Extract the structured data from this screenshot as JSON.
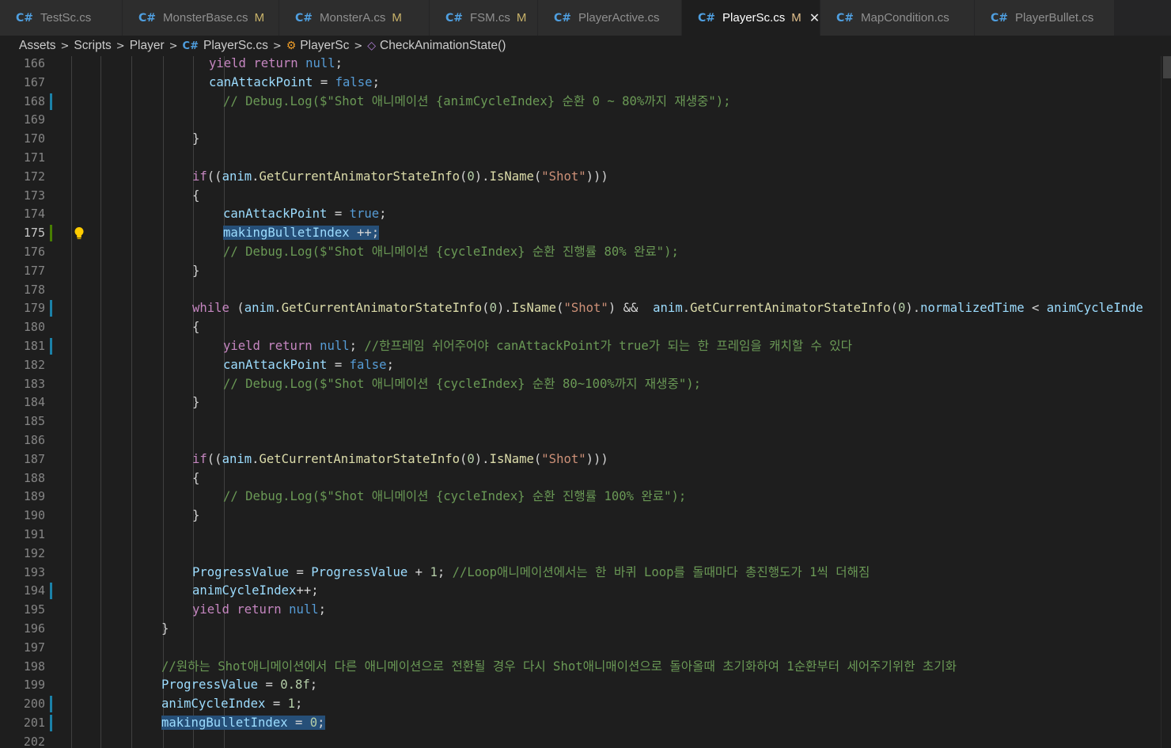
{
  "tabs": [
    {
      "label": "TestSc.cs",
      "modified": "",
      "active": false
    },
    {
      "label": "MonsterBase.cs",
      "modified": "M",
      "active": false
    },
    {
      "label": "MonsterA.cs",
      "modified": "M",
      "active": false
    },
    {
      "label": "FSM.cs",
      "modified": "M",
      "active": false
    },
    {
      "label": "PlayerActive.cs",
      "modified": "",
      "active": false
    },
    {
      "label": "PlayerSc.cs",
      "modified": "M",
      "active": true
    },
    {
      "label": "MapCondition.cs",
      "modified": "",
      "active": false
    },
    {
      "label": "PlayerBullet.cs",
      "modified": "",
      "active": false
    }
  ],
  "breadcrumb": {
    "assets": "Assets",
    "scripts": "Scripts",
    "player": "Player",
    "file": "PlayerSc.cs",
    "class": "PlayerSc",
    "method": "CheckAnimationState()"
  },
  "editor": {
    "current_line": "175",
    "lines": [
      {
        "n": "166",
        "g": "",
        "indent": 2,
        "tokens": [
          [
            "yl",
            "yield "
          ],
          [
            "yl",
            "return "
          ],
          [
            "kw2",
            "null"
          ],
          [
            "",
            "; "
          ]
        ]
      },
      {
        "n": "167",
        "g": "",
        "indent": 2,
        "tokens": [
          [
            "id",
            "canAttackPoint"
          ],
          [
            "",
            " = "
          ],
          [
            "kw2",
            "false"
          ],
          [
            "",
            ";"
          ]
        ]
      },
      {
        "n": "168",
        "g": "mod",
        "indent": 3,
        "tokens": [
          [
            "cm",
            "// Debug.Log($\"Shot 애니메이션 {animCycleIndex} 순환 0 ~ 80%까지 재생중\");"
          ]
        ]
      },
      {
        "n": "169",
        "g": "",
        "indent": 0,
        "tokens": []
      },
      {
        "n": "170",
        "g": "",
        "indent": 1,
        "tokens": [
          [
            "",
            "}"
          ]
        ]
      },
      {
        "n": "171",
        "g": "",
        "indent": 0,
        "tokens": []
      },
      {
        "n": "172",
        "g": "",
        "indent": 1,
        "tokens": [
          [
            "kw",
            "if"
          ],
          [
            "",
            "(("
          ],
          [
            "id",
            "anim"
          ],
          [
            "",
            "."
          ],
          [
            "fn",
            "GetCurrentAnimatorStateInfo"
          ],
          [
            "",
            "("
          ],
          [
            "num",
            "0"
          ],
          [
            "",
            ")."
          ],
          [
            "fn",
            "IsName"
          ],
          [
            "",
            "("
          ],
          [
            "str",
            "\"Shot\""
          ],
          [
            "",
            ")))"
          ]
        ]
      },
      {
        "n": "173",
        "g": "",
        "indent": 1,
        "tokens": [
          [
            "",
            "{"
          ]
        ]
      },
      {
        "n": "174",
        "g": "",
        "indent": 3,
        "tokens": [
          [
            "id",
            "canAttackPoint"
          ],
          [
            "",
            " = "
          ],
          [
            "kw2",
            "true"
          ],
          [
            "",
            ";"
          ]
        ]
      },
      {
        "n": "175",
        "g": "add",
        "indent": 3,
        "sel": true,
        "tokens": [
          [
            "id",
            "makingBulletIndex"
          ],
          [
            "",
            " ++;"
          ]
        ]
      },
      {
        "n": "176",
        "g": "",
        "indent": 3,
        "tokens": [
          [
            "cm",
            "// Debug.Log($\"Shot 애니메이션 {cycleIndex} 순환 진행률 80% 완료\");"
          ]
        ]
      },
      {
        "n": "177",
        "g": "",
        "indent": 1,
        "tokens": [
          [
            "",
            "}"
          ]
        ]
      },
      {
        "n": "178",
        "g": "",
        "indent": 0,
        "tokens": []
      },
      {
        "n": "179",
        "g": "mod",
        "indent": 1,
        "tokens": [
          [
            "kw",
            "while"
          ],
          [
            "",
            " ("
          ],
          [
            "id",
            "anim"
          ],
          [
            "",
            "."
          ],
          [
            "fn",
            "GetCurrentAnimatorStateInfo"
          ],
          [
            "",
            "("
          ],
          [
            "num",
            "0"
          ],
          [
            "",
            ")."
          ],
          [
            "fn",
            "IsName"
          ],
          [
            "",
            "("
          ],
          [
            "str",
            "\"Shot\""
          ],
          [
            "",
            ") &&  "
          ],
          [
            "id",
            "anim"
          ],
          [
            "",
            "."
          ],
          [
            "fn",
            "GetCurrentAnimatorStateInfo"
          ],
          [
            "",
            "("
          ],
          [
            "num",
            "0"
          ],
          [
            "",
            ")."
          ],
          [
            "id",
            "normalizedTime"
          ],
          [
            "",
            " < "
          ],
          [
            "id",
            "animCycleInde"
          ]
        ]
      },
      {
        "n": "180",
        "g": "",
        "indent": 1,
        "tokens": [
          [
            "",
            "{"
          ]
        ]
      },
      {
        "n": "181",
        "g": "mod",
        "indent": 3,
        "tokens": [
          [
            "yl",
            "yield "
          ],
          [
            "yl",
            "return "
          ],
          [
            "kw2",
            "null"
          ],
          [
            "",
            "; "
          ],
          [
            "cm",
            "//한프레임 쉬어주어야 canAttackPoint가 true가 되는 한 프레임을 캐치할 수 있다"
          ]
        ]
      },
      {
        "n": "182",
        "g": "",
        "indent": 3,
        "tokens": [
          [
            "id",
            "canAttackPoint"
          ],
          [
            "",
            " = "
          ],
          [
            "kw2",
            "false"
          ],
          [
            "",
            ";"
          ]
        ]
      },
      {
        "n": "183",
        "g": "",
        "indent": 3,
        "tokens": [
          [
            "cm",
            "// Debug.Log($\"Shot 애니메이션 {cycleIndex} 순환 80~100%까지 재생중\");"
          ]
        ]
      },
      {
        "n": "184",
        "g": "",
        "indent": 1,
        "tokens": [
          [
            "",
            "}"
          ]
        ]
      },
      {
        "n": "185",
        "g": "",
        "indent": 0,
        "tokens": []
      },
      {
        "n": "186",
        "g": "",
        "indent": 0,
        "tokens": []
      },
      {
        "n": "187",
        "g": "",
        "indent": 1,
        "tokens": [
          [
            "kw",
            "if"
          ],
          [
            "",
            "(("
          ],
          [
            "id",
            "anim"
          ],
          [
            "",
            "."
          ],
          [
            "fn",
            "GetCurrentAnimatorStateInfo"
          ],
          [
            "",
            "("
          ],
          [
            "num",
            "0"
          ],
          [
            "",
            ")."
          ],
          [
            "fn",
            "IsName"
          ],
          [
            "",
            "("
          ],
          [
            "str",
            "\"Shot\""
          ],
          [
            "",
            ")))"
          ]
        ]
      },
      {
        "n": "188",
        "g": "",
        "indent": 1,
        "tokens": [
          [
            "",
            "{"
          ]
        ]
      },
      {
        "n": "189",
        "g": "",
        "indent": 3,
        "tokens": [
          [
            "cm",
            "// Debug.Log($\"Shot 애니메이션 {cycleIndex} 순환 진행률 100% 완료\");"
          ]
        ]
      },
      {
        "n": "190",
        "g": "",
        "indent": 1,
        "tokens": [
          [
            "",
            "}"
          ]
        ]
      },
      {
        "n": "191",
        "g": "",
        "indent": 0,
        "tokens": []
      },
      {
        "n": "192",
        "g": "",
        "indent": 0,
        "tokens": []
      },
      {
        "n": "193",
        "g": "",
        "indent": 1,
        "tokens": [
          [
            "id",
            "ProgressValue"
          ],
          [
            "",
            " = "
          ],
          [
            "id",
            "ProgressValue"
          ],
          [
            "",
            " + "
          ],
          [
            "num",
            "1"
          ],
          [
            "",
            "; "
          ],
          [
            "cm",
            "//Loop애니메이션에서는 한 바퀴 Loop를 돌때마다 총진행도가 1씩 더해짐"
          ]
        ]
      },
      {
        "n": "194",
        "g": "mod",
        "indent": 1,
        "tokens": [
          [
            "id",
            "animCycleIndex"
          ],
          [
            "",
            "++;"
          ]
        ]
      },
      {
        "n": "195",
        "g": "",
        "indent": 1,
        "tokens": [
          [
            "yl",
            "yield "
          ],
          [
            "yl",
            "return "
          ],
          [
            "kw2",
            "null"
          ],
          [
            "",
            ";"
          ]
        ]
      },
      {
        "n": "196",
        "g": "",
        "indent": 0,
        "tokens": [
          [
            "",
            "}"
          ]
        ]
      },
      {
        "n": "197",
        "g": "",
        "indent": 0,
        "tokens": []
      },
      {
        "n": "198",
        "g": "",
        "indent": 0,
        "tokens": [
          [
            "cm",
            "//원하는 Shot애니메이션에서 다른 애니메이션으로 전환될 경우 다시 Shot애니매이션으로 돌아올때 초기화하여 1순환부터 세어주기위한 초기화"
          ]
        ]
      },
      {
        "n": "199",
        "g": "",
        "indent": 0,
        "tokens": [
          [
            "id",
            "ProgressValue"
          ],
          [
            "",
            " = "
          ],
          [
            "num",
            "0.8f"
          ],
          [
            "",
            ";"
          ]
        ]
      },
      {
        "n": "200",
        "g": "mod",
        "indent": 0,
        "tokens": [
          [
            "id",
            "animCycleIndex"
          ],
          [
            "",
            " = "
          ],
          [
            "num",
            "1"
          ],
          [
            "",
            ";"
          ]
        ]
      },
      {
        "n": "201",
        "g": "mod",
        "indent": 0,
        "sel": true,
        "tokens": [
          [
            "id",
            "makingBulletIndex"
          ],
          [
            "",
            " = "
          ],
          [
            "num",
            "0"
          ],
          [
            "",
            ";"
          ]
        ]
      },
      {
        "n": "202",
        "g": "",
        "indent": 0,
        "tokens": []
      }
    ]
  }
}
